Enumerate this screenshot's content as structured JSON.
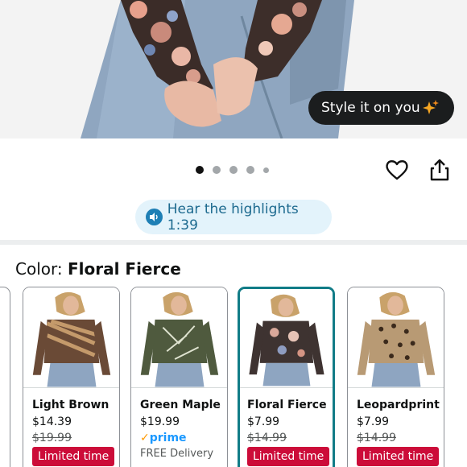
{
  "hero": {
    "style_button_label": "Style it on you",
    "carousel_dots": 5,
    "carousel_active_index": 0
  },
  "highlights": {
    "label": "Hear the highlights 1:39"
  },
  "color_selector": {
    "prefix": "Color:",
    "selected_name": "Floral Fierce"
  },
  "swatches": [
    {
      "name": "Light Brown",
      "price": "$14.39",
      "was": "$19.99",
      "badge": "Limited time"
    },
    {
      "name": "Green Maple",
      "price": "$19.99",
      "prime": "prime",
      "delivery": "FREE Delivery"
    },
    {
      "name": "Floral Fierce",
      "price": "$7.99",
      "was": "$14.99",
      "badge": "Limited time"
    },
    {
      "name": "Leopardprint",
      "price": "$7.99",
      "was": "$14.99",
      "badge": "Limited time"
    }
  ],
  "colors": {
    "selected_border": "#117c87",
    "deal_badge": "#cc0c39",
    "highlights_bg": "#e3f3fb",
    "highlights_text": "#1d6a8f"
  }
}
